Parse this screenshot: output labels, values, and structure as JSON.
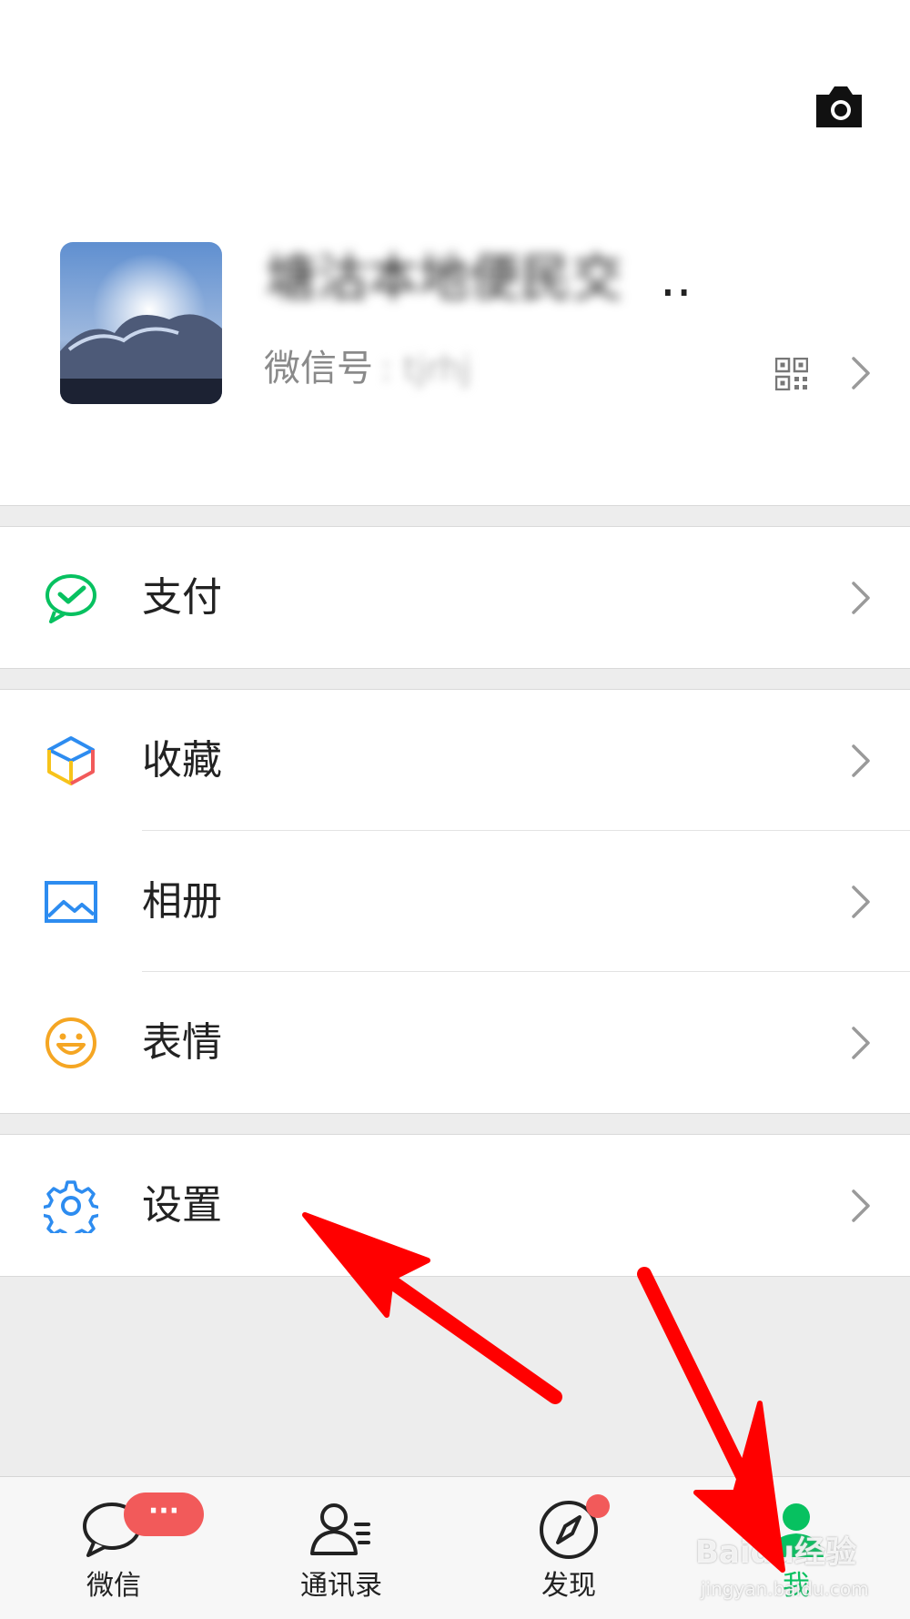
{
  "profile": {
    "nickname": "塘沽本地便民交",
    "nickname_ellipsis": "..",
    "wechat_id_label": "微信号",
    "wechat_id_value": ": tjrhj"
  },
  "menu": {
    "pay": {
      "label": "支付",
      "icon": "wechat-pay-icon"
    },
    "favorites": {
      "label": "收藏",
      "icon": "favorites-cube-icon"
    },
    "album": {
      "label": "相册",
      "icon": "album-image-icon"
    },
    "stickers": {
      "label": "表情",
      "icon": "smiley-icon"
    },
    "settings": {
      "label": "设置",
      "icon": "gear-icon"
    }
  },
  "tabbar": {
    "chats": {
      "label": "微信",
      "badge": "···"
    },
    "contacts": {
      "label": "通讯录"
    },
    "discover": {
      "label": "发现"
    },
    "me": {
      "label": "我"
    }
  },
  "watermark": {
    "text": "Baidu经验",
    "sub": "jingyan.baidu.com"
  },
  "colors": {
    "wechat_green": "#07c160",
    "badge_red": "#f25a5a",
    "arrow_red": "#ff0000",
    "background": "#ededed"
  }
}
